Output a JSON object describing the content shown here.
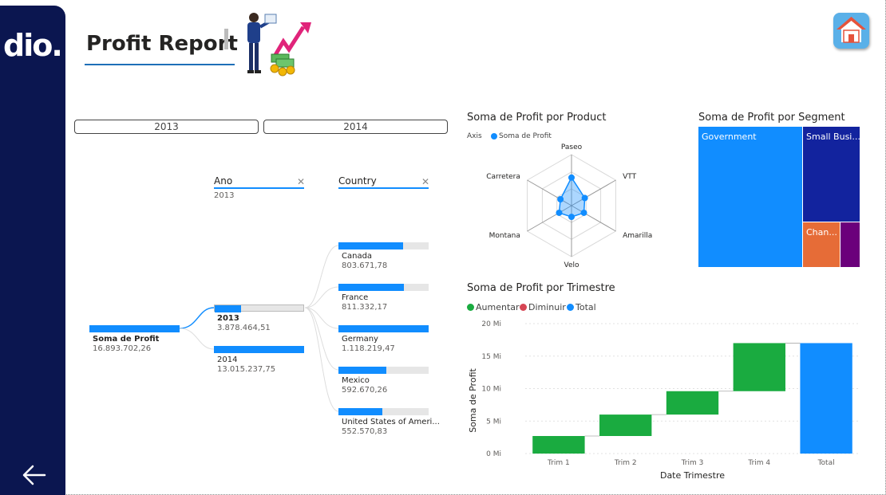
{
  "nav": {
    "logo_text": "dio."
  },
  "header": {
    "title": "Profit Report"
  },
  "slicer": {
    "years": [
      "2013",
      "2014"
    ]
  },
  "decomposition_tree": {
    "root": {
      "label": "Soma de Profit",
      "value": "16.893.702,26",
      "fill": 1.0
    },
    "levels": [
      {
        "header": "Ano",
        "selected": "2013"
      },
      {
        "header": "Country",
        "selected": ""
      }
    ],
    "ano_nodes": [
      {
        "label": "2013",
        "value": "3.878.464,51",
        "fill": 0.3,
        "selected": true
      },
      {
        "label": "2014",
        "value": "13.015.237,75",
        "fill": 1.0,
        "selected": false
      }
    ],
    "country_nodes": [
      {
        "label": "Canada",
        "value": "803.671,78",
        "fill": 0.72
      },
      {
        "label": "France",
        "value": "811.332,17",
        "fill": 0.73
      },
      {
        "label": "Germany",
        "value": "1.118.219,47",
        "fill": 1.0
      },
      {
        "label": "Mexico",
        "value": "592.670,26",
        "fill": 0.53
      },
      {
        "label": "United States of Ameri...",
        "value": "552.570,83",
        "fill": 0.49
      }
    ]
  },
  "radar": {
    "title": "Soma de Profit por Product",
    "legend_axis": "Axis",
    "legend_series": "Soma de Profit",
    "color": "#118dff",
    "chart_data": {
      "type": "radar",
      "categories": [
        "Paseo",
        "VTT",
        "Amarilla",
        "Velo",
        "Montana",
        "Carretera"
      ],
      "values": [
        0.55,
        0.3,
        0.28,
        0.22,
        0.28,
        0.25
      ]
    }
  },
  "treemap": {
    "title": "Soma de Profit por Segment",
    "cells": [
      {
        "label": "Government",
        "color": "#118dff"
      },
      {
        "label": "Small Busi...",
        "color": "#12239e"
      },
      {
        "label": "Chan...",
        "color": "#e66c37"
      },
      {
        "label": "",
        "color": "#6b007b"
      }
    ]
  },
  "waterfall": {
    "title": "Soma de Profit por Trimestre",
    "legend": [
      {
        "label": "Aumentar",
        "color": "#1aab40"
      },
      {
        "label": "Diminuir",
        "color": "#d64554"
      },
      {
        "label": "Total",
        "color": "#118dff"
      }
    ],
    "chart_data": {
      "type": "waterfall",
      "categories": [
        "Trim 1",
        "Trim 2",
        "Trim 3",
        "Trim 4",
        "Total"
      ],
      "values": [
        2.7,
        3.3,
        3.6,
        7.4,
        17.0
      ],
      "cumulative_start": [
        0,
        2.7,
        6.0,
        9.6,
        0
      ],
      "kinds": [
        "increase",
        "increase",
        "increase",
        "increase",
        "total"
      ],
      "ylim": [
        0,
        20
      ],
      "yticks": [
        "0 Mi",
        "5 Mi",
        "10 Mi",
        "15 Mi",
        "20 Mi"
      ],
      "ytick_values": [
        0,
        5,
        10,
        15,
        20
      ],
      "xlabel": "Date Trimestre",
      "ylabel": "Soma de Profit"
    }
  }
}
